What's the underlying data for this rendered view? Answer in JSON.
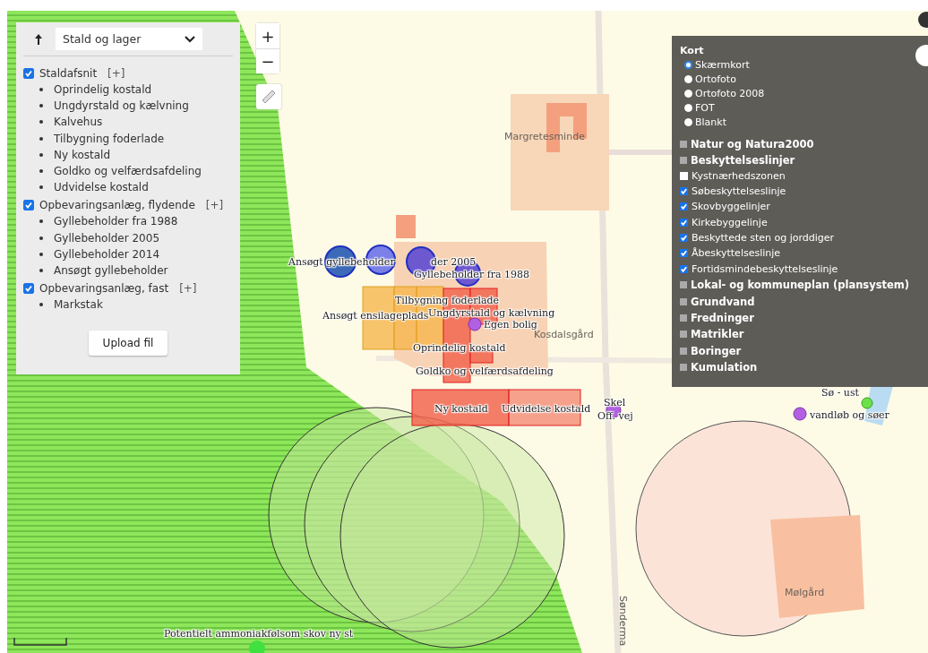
{
  "layer_panel": {
    "select": "Stald og lager",
    "groups": [
      {
        "label": "Staldafsnit",
        "checked": true,
        "expand": "[+]",
        "items": [
          "Oprindelig kostald",
          "Ungdyrstald og kælvning",
          "Kalvehus",
          "Tilbygning foderlade",
          "Ny kostald",
          "Goldko og velfærdsafdeling",
          "Udvidelse kostald"
        ]
      },
      {
        "label": "Opbevaringsanlæg, flydende",
        "checked": true,
        "expand": "[+]",
        "items": [
          "Gyllebeholder fra 1988",
          "Gyllebeholder 2005",
          "Gyllebeholder 2014",
          "Ansøgt gyllebeholder"
        ]
      },
      {
        "label": "Opbevaringsanlæg, fast",
        "checked": true,
        "expand": "[+]",
        "items": [
          "Markstak"
        ]
      }
    ],
    "upload_button": "Upload fil"
  },
  "zoom_controls": {
    "zoom_in": "+",
    "zoom_out": "−"
  },
  "kort_panel": {
    "title": "Kort",
    "basemaps": [
      {
        "label": "Skærmkort",
        "selected": true
      },
      {
        "label": "Ortofoto",
        "selected": false
      },
      {
        "label": "Ortofoto 2008",
        "selected": false
      },
      {
        "label": "FOT",
        "selected": false
      },
      {
        "label": "Blankt",
        "selected": false
      }
    ],
    "layers": [
      {
        "kind": "group",
        "label": "Natur og Natura2000"
      },
      {
        "kind": "group",
        "label": "Beskyttelseslinjer"
      },
      {
        "kind": "check",
        "label": "Kystnærhedszonen",
        "checked": false
      },
      {
        "kind": "check",
        "label": "Søbeskyttelseslinje",
        "checked": true
      },
      {
        "kind": "check",
        "label": "Skovbyggelinjer",
        "checked": true
      },
      {
        "kind": "check",
        "label": "Kirkebyggelinje",
        "checked": true
      },
      {
        "kind": "check",
        "label": "Beskyttede sten og jorddiger",
        "checked": true
      },
      {
        "kind": "check",
        "label": "Åbeskyttelseslinje",
        "checked": true
      },
      {
        "kind": "check",
        "label": "Fortidsmindebeskyttelseslinje",
        "checked": true
      },
      {
        "kind": "group",
        "label": "Lokal- og kommuneplan (plansystem)"
      },
      {
        "kind": "group",
        "label": "Grundvand"
      },
      {
        "kind": "group",
        "label": "Fredninger"
      },
      {
        "kind": "group",
        "label": "Matrikler"
      },
      {
        "kind": "group",
        "label": "Boringer"
      },
      {
        "kind": "group",
        "label": "Kumulation"
      }
    ]
  },
  "map_labels": [
    {
      "kind": "place",
      "text": "Margretesminde"
    },
    {
      "kind": "feature",
      "text": "Ansøgt gyllebeholder"
    },
    {
      "kind": "feature",
      "text": "der 2005"
    },
    {
      "kind": "feature",
      "text": "Gyllebeholder fra 1988"
    },
    {
      "kind": "feature",
      "text": "Tilbygning foderlade"
    },
    {
      "kind": "feature",
      "text": "Ansøgt ensilageplads"
    },
    {
      "kind": "feature",
      "text": "Ungdyrstald og kælvning"
    },
    {
      "kind": "feature",
      "text": "Egen bolig"
    },
    {
      "kind": "place",
      "text": "Kosdalsgård"
    },
    {
      "kind": "feature",
      "text": "Oprindelig kostald"
    },
    {
      "kind": "feature",
      "text": "Goldko og velfærdsafdeling"
    },
    {
      "kind": "feature",
      "text": "Ny kostald"
    },
    {
      "kind": "feature",
      "text": "Udvidelse kostald"
    },
    {
      "kind": "feature",
      "text": "Skel"
    },
    {
      "kind": "feature",
      "text": "Off. vej"
    },
    {
      "kind": "feature",
      "text": "Sø - ust"
    },
    {
      "kind": "feature",
      "text": "vandløb og søer"
    },
    {
      "kind": "place",
      "text": "Mølgård"
    },
    {
      "kind": "road",
      "text": "Sønderma"
    },
    {
      "kind": "feature",
      "text": "Potentielt ammoniakfølsom skov ny st"
    }
  ]
}
